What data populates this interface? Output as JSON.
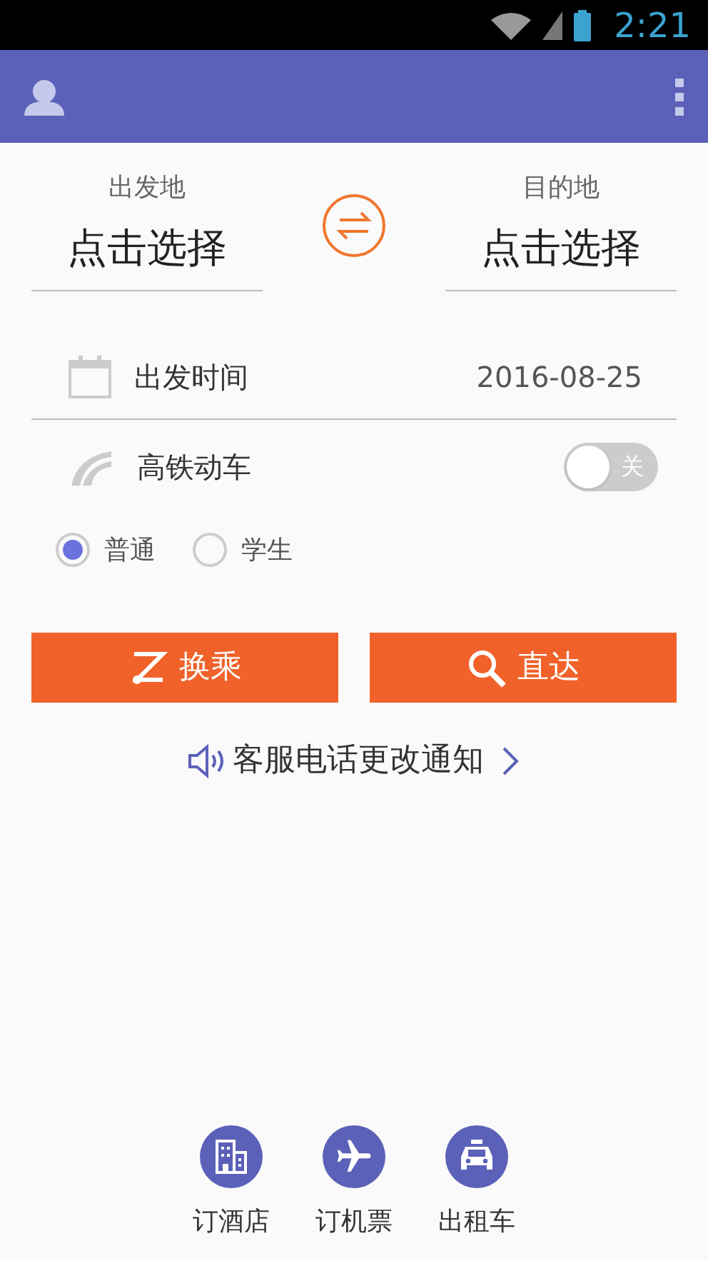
{
  "status_bar": {
    "time": "2:21"
  },
  "stations": {
    "from": {
      "label": "出发地",
      "value": "点击选择"
    },
    "to": {
      "label": "目的地",
      "value": "点击选择"
    }
  },
  "date": {
    "label": "出发时间",
    "value": "2016-08-25"
  },
  "high_speed": {
    "label": "高铁动车",
    "on": false,
    "switch_text": "关"
  },
  "ticket_types": [
    {
      "label": "普通",
      "selected": true
    },
    {
      "label": "学生",
      "selected": false
    }
  ],
  "buttons": [
    {
      "kind": "transfer",
      "label": "换乘"
    },
    {
      "kind": "direct",
      "label": "直达"
    }
  ],
  "notice": "客服电话更改通知",
  "bottom_links": [
    {
      "kind": "hotel",
      "label": "订酒店"
    },
    {
      "kind": "plane",
      "label": "订机票"
    },
    {
      "kind": "taxi",
      "label": "出租车"
    }
  ]
}
